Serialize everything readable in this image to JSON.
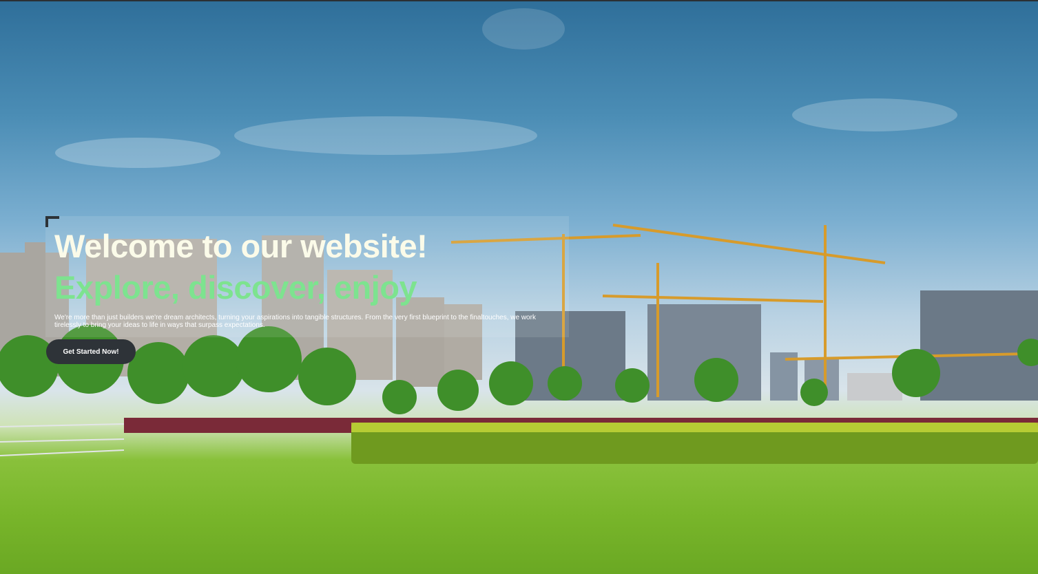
{
  "hero": {
    "title": "Welcome to our website!",
    "subtitle": "Explore, discover, enjoy",
    "description": "We're more than just builders we're dream architects, turning your aspirations into tangible structures. From the very first blueprint to the finaltouches, we work tirelessly to bring your ideas to life in ways that surpass expectations.",
    "cta_label": "Get Started Now!"
  },
  "colors": {
    "title": "#fbfbe9",
    "subtitle": "#7de38f",
    "button_bg": "#2e3338"
  }
}
